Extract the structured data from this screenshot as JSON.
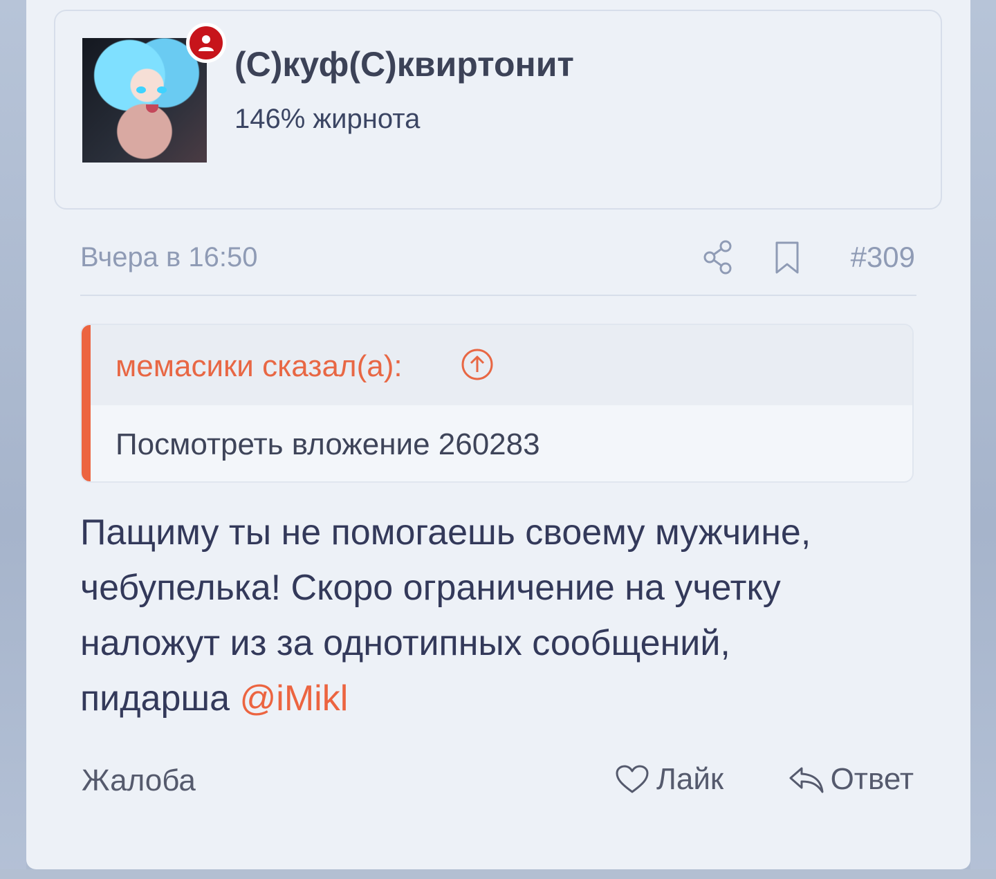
{
  "user_card": {
    "username": "(С)куф(С)квиртонит",
    "title": "146% жирнота"
  },
  "post_meta": {
    "timestamp": "Вчера в 16:50",
    "post_number": "#309"
  },
  "quote": {
    "author": "мемасики сказал(а):",
    "text": "Посмотреть вложение 260283"
  },
  "post": {
    "body_lines": [
      "Пащиму ты не помогаешь своему мужчине,",
      "чебупелька! Скоро ограничение на учетку",
      "наложут из за однотипных сообщений,",
      "пидарша "
    ],
    "mention": "@iMikl"
  },
  "actions": {
    "report": "Жалоба",
    "like": "Лайк",
    "reply": "Ответ"
  },
  "colors": {
    "accent": "#ec6440",
    "badge": "#c7141b",
    "muted": "#8f9bb5",
    "text": "#33395a"
  }
}
